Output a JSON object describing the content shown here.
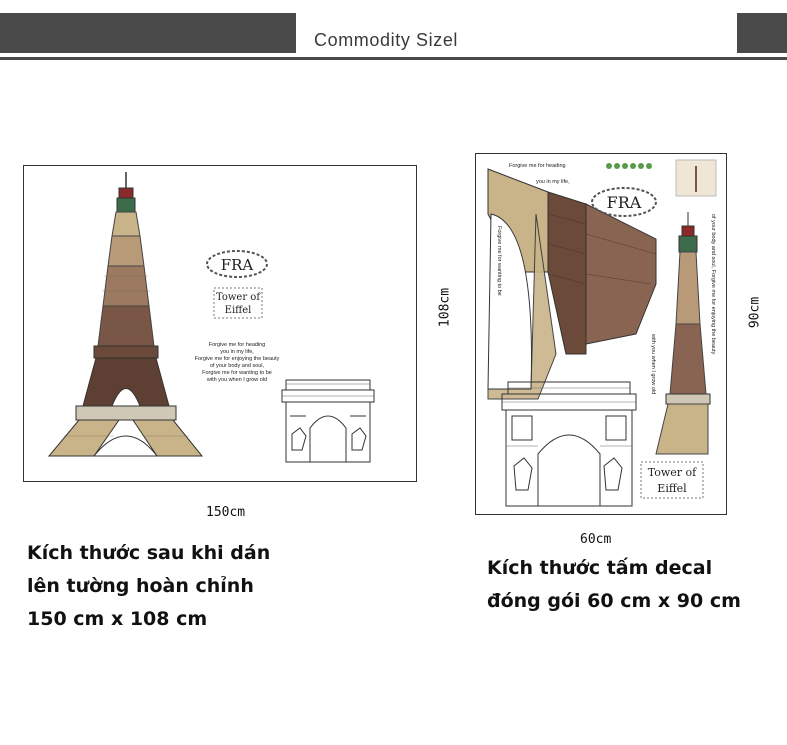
{
  "header": {
    "title": "Commodity Sizel"
  },
  "left_product": {
    "width_label": "150cm",
    "height_label": "108cm",
    "art": {
      "fra": "FRA",
      "tower_line1": "Tower of",
      "tower_line2": "Eiffel",
      "poem": [
        "Forgive me for heading",
        "you in my life,",
        "Forgive me for enjoying the beauty",
        "of your body and soul,",
        "Forgive me for wanting to be",
        "with you when I grow old"
      ]
    },
    "caption": [
      "Kích thước sau khi dán",
      "lên tường hoàn chỉnh",
      "150 cm x 108 cm"
    ]
  },
  "right_product": {
    "width_label": "60cm",
    "height_label": "90cm",
    "art": {
      "fra": "FRA",
      "tower_line1": "Tower of",
      "tower_line2": "Eiffel",
      "top_text1": "Forgive me for heading",
      "top_text2": "you in my life,",
      "side_left": "Forgive me for wanting to be",
      "side_mid": "with you when I grow old",
      "side_right": "of your body and soul, Forgive me for enjoying the beauty"
    },
    "caption": [
      "Kích thước tấm decal",
      "đóng gói 60 cm x 90 cm"
    ]
  },
  "colors": {
    "header": "#4a4a4a",
    "tower_brown": "#6b4a3a",
    "tower_tan": "#c9b48a"
  }
}
